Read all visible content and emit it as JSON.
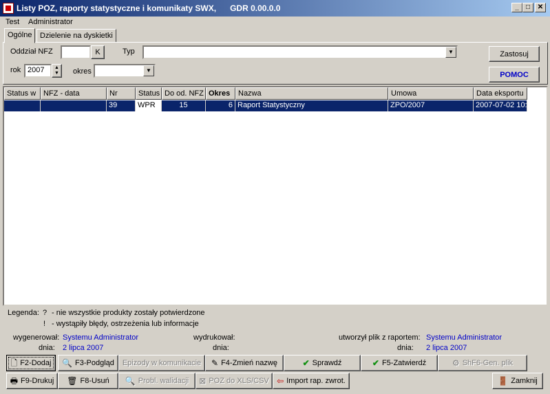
{
  "window": {
    "title": "Listy POZ, raporty statystyczne i komunikaty SWX,      GDR 0.00.0.0",
    "minimize": "_",
    "maximize": "□",
    "close": "✕"
  },
  "menu": {
    "items": [
      "Test",
      "Administrator"
    ]
  },
  "tabs": [
    {
      "label": "Ogólne",
      "active": true
    },
    {
      "label": "Dzielenie na dyskietki",
      "active": false
    }
  ],
  "filters": {
    "oddzial_label": "Oddział NFZ",
    "oddzial_value": "",
    "oddzial_button": "K",
    "typ_label": "Typ",
    "typ_value": "",
    "rok_label": "rok",
    "rok_value": "2007",
    "okres_label": "okres",
    "okres_value": "",
    "apply_button": "Zastosuj",
    "help_button": "POMOC"
  },
  "grid": {
    "columns": [
      "Status w",
      "NFZ - data",
      "Nr",
      "Status",
      "Do od. NFZ",
      "Okres",
      "Nazwa",
      "Umowa",
      "Data eksportu"
    ],
    "rows": [
      [
        "",
        "",
        "39",
        "WPR",
        "15",
        "6",
        "Raport Statystyczny",
        "ZPO/2007",
        "2007-07-02 10:"
      ]
    ]
  },
  "legend": {
    "title": "Legenda:",
    "q_mark": "?",
    "q_text": "- nie wszystkie produkty zostały potwierdzone",
    "e_mark": "!",
    "e_text": "- wystąpiły błędy, ostrzeżenia lub informacje"
  },
  "info": {
    "generated_label": "wygenerował:",
    "generated_by": "Systemu Administrator",
    "generated_date_label": "dnia:",
    "generated_date": "2 lipca 2007",
    "printed_label": "wydrukował:",
    "printed_by": "",
    "printed_date_label": "dnia:",
    "printed_date": "",
    "file_label": "utworzył plik z raportem:",
    "file_by": "Systemu Administrator",
    "file_date_label": "dnia:",
    "file_date": "2 lipca 2007"
  },
  "buttons": {
    "add": "F2-Dodaj",
    "preview": "F3-Podgląd",
    "episodes": "Epizody w komunikacie",
    "rename": "F4-Zmień nazwę",
    "check": "Sprawdź",
    "approve": "F5-Zatwierdź",
    "gen_file": "ShF6-Gen. plik",
    "print": "F9-Drukuj",
    "delete": "F8-Usuń",
    "validation": "Probl. walidacji",
    "export": "POZ do XLS/CSV",
    "import": "Import rap. zwrot.",
    "close": "Zamknij"
  },
  "colors": {
    "selection": "#0a246a",
    "link": "#0000c8",
    "face": "#d4d0c8"
  }
}
